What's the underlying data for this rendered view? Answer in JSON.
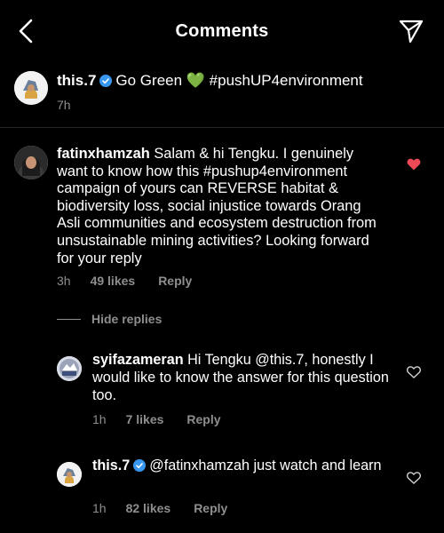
{
  "header": {
    "title": "Comments"
  },
  "caption": {
    "username": "this.7",
    "text": "Go Green 💚 #pushUP4environment",
    "time": "7h"
  },
  "comment": {
    "username": "fatinxhamzah",
    "text": "Salam & hi Tengku. I genuinely want to know how this #pushup4environment campaign of yours can REVERSE habitat & biodiversity loss, social injustice towards Orang Asli communities and ecosystem destruction from unsustainable mining activities? Looking forward for your reply",
    "time": "3h",
    "likes": "49 likes",
    "reply_label": "Reply",
    "liked": true,
    "liked_color": "#ed4956"
  },
  "hide_replies_label": "Hide replies",
  "replies": [
    {
      "username": "syifazameran",
      "text": "Hi Tengku @this.7, honestly I would like to know the answer for this question too.",
      "time": "1h",
      "likes": "7 likes",
      "reply_label": "Reply"
    },
    {
      "username": "this.7",
      "text": "@fatinxhamzah just watch and learn",
      "time": "1h",
      "likes": "82 likes",
      "reply_label": "Reply"
    }
  ],
  "colors": {
    "background": "#000000",
    "secondary_text": "#8e8e8e",
    "verified_badge": "#3897f0"
  }
}
